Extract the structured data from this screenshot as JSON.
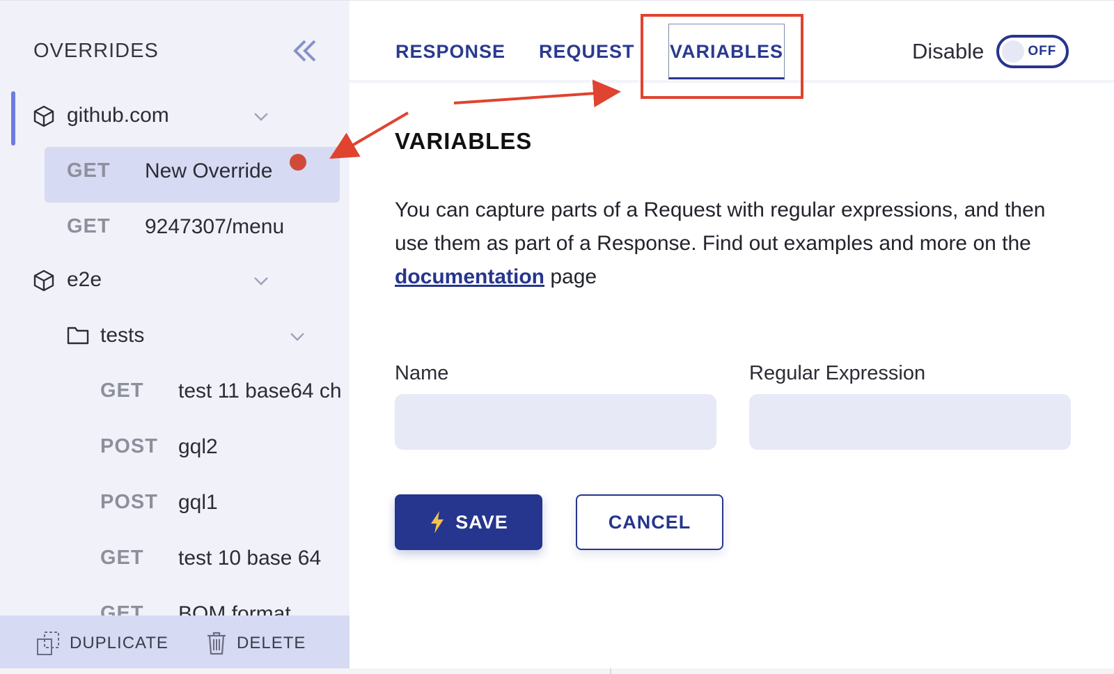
{
  "sidebar": {
    "title": "OVERRIDES",
    "groups": [
      {
        "name": "github.com"
      },
      {
        "name": "e2e"
      }
    ],
    "folder": {
      "name": "tests"
    },
    "items": [
      {
        "method": "GET",
        "label": "New Override"
      },
      {
        "method": "GET",
        "label": "9247307/menu"
      },
      {
        "method": "GET",
        "label": "test 11 base64 ch"
      },
      {
        "method": "POST",
        "label": "gql2"
      },
      {
        "method": "POST",
        "label": "gql1"
      },
      {
        "method": "GET",
        "label": "test 10 base 64"
      },
      {
        "method": "GET",
        "label": "BOM format"
      }
    ],
    "footer": {
      "duplicate_label": "DUPLICATE",
      "delete_label": "DELETE"
    }
  },
  "tabs": [
    {
      "label": "RESPONSE"
    },
    {
      "label": "REQUEST"
    },
    {
      "label": "VARIABLES"
    }
  ],
  "disable": {
    "label": "Disable",
    "toggle_text": "OFF"
  },
  "content": {
    "title": "VARIABLES",
    "desc_part1": "You can capture parts of a Request with regular expressions, and then use them as part of a Response. Find out examples and more on the ",
    "desc_link": "documentation",
    "desc_part2": " page",
    "name_label": "Name",
    "regex_label": "Regular Expression",
    "save_label": "SAVE",
    "cancel_label": "CANCEL"
  },
  "colors": {
    "accent": "#26358d",
    "annotation": "#e0432f",
    "unsaved_dot": "#d04a3a"
  }
}
